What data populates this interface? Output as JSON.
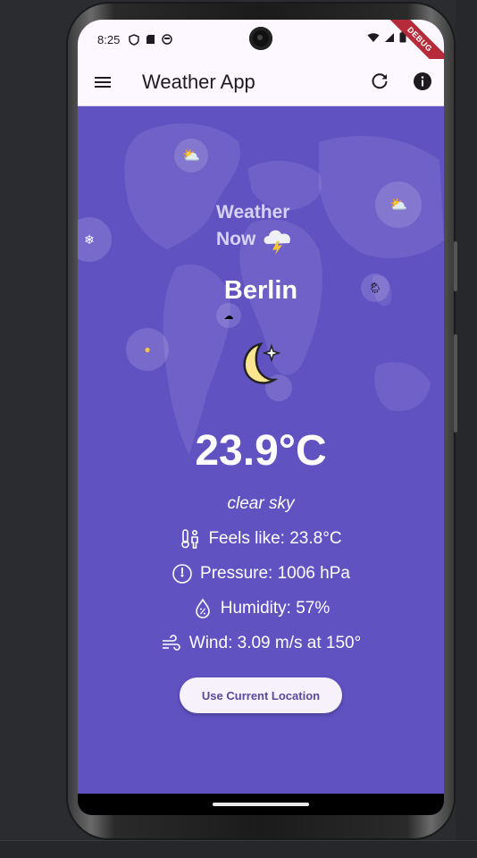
{
  "status_bar": {
    "time": "8:25",
    "icons": [
      "shield-icon",
      "sd-card-icon",
      "face-icon"
    ],
    "right_icons": [
      "wifi-icon",
      "signal-icon",
      "battery-icon"
    ]
  },
  "debug_banner": "DEBUG",
  "app_bar": {
    "title": "Weather App",
    "actions": [
      "menu-icon",
      "refresh-icon",
      "info-icon"
    ]
  },
  "logo": {
    "line1": "Weather",
    "line2": "Now"
  },
  "weather": {
    "city": "Berlin",
    "icon": "moon-clear-night-icon",
    "temperature": "23.9°C",
    "description": "clear sky",
    "feels_like": "Feels like: 23.8°C",
    "pressure": "Pressure: 1006 hPa",
    "humidity": "Humidity: 57%",
    "wind": "Wind: 3.09 m/s at 150°"
  },
  "actions": {
    "use_location": "Use Current Location"
  },
  "colors": {
    "background": "#6152c2",
    "app_bar": "#fdf7ff",
    "button_bg": "#f6f1fa",
    "button_text": "#5a4a9a",
    "debug_banner": "#b52b3a"
  }
}
